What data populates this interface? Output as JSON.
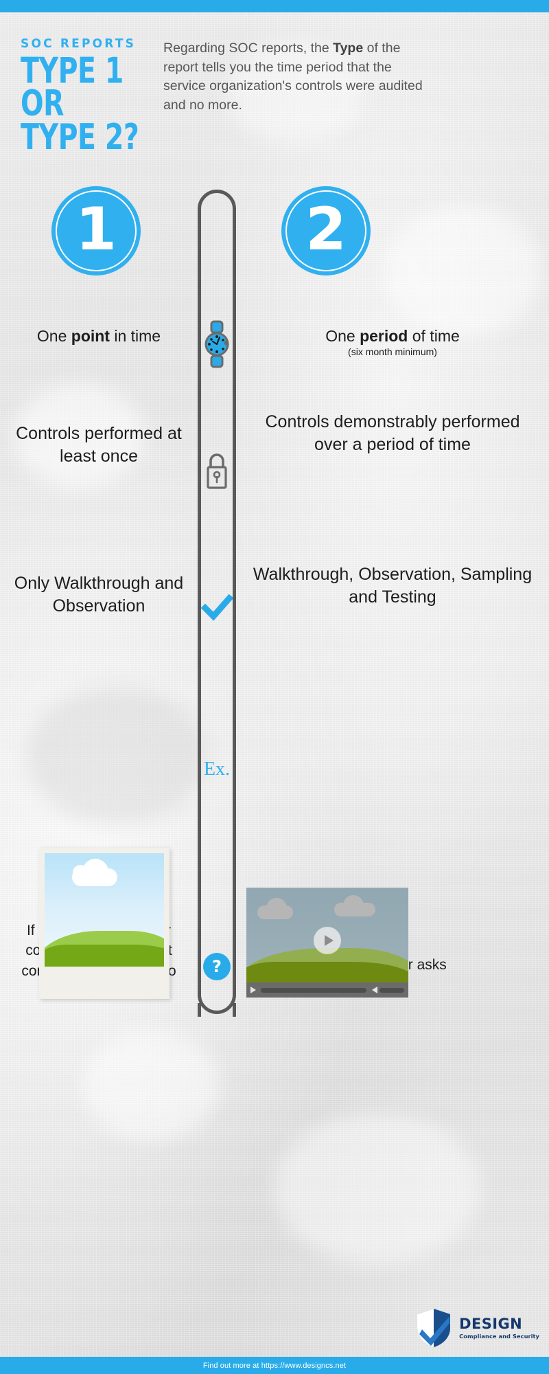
{
  "header": {
    "kicker": "SOC REPORTS",
    "title_line1": "TYPE 1 OR",
    "title_line2": "TYPE 2?",
    "intro_part1": "Regarding SOC reports, the ",
    "intro_bold": "Type",
    "intro_part2": " of the report tells you the time period that the service organization's controls were audited and no more."
  },
  "badges": {
    "left": "1",
    "right": "2"
  },
  "rows": [
    {
      "icon": "wristwatch-icon",
      "left": "One point in time",
      "left_bold": "point",
      "right": "One period of time",
      "right_bold": "period",
      "right_sub": "(six month minimum)"
    },
    {
      "icon": "padlock-icon",
      "left": "Controls performed at least once",
      "right": "Controls demonstrably performed over a period of time"
    },
    {
      "icon": "checkmark-icon",
      "left": "Only Walkthrough and Observation",
      "right": "Walkthrough, Observation, Sampling and Testing"
    },
    {
      "icon": "ex-label",
      "icon_label": "Ex.",
      "left": "photograph-polaroid",
      "right": "video-player"
    },
    {
      "icon": "question-mark-icon",
      "icon_label": "?",
      "left": "If Customer asks, your controls are new or not confident in the ability to pass a Type 2",
      "right": "If Customer asks"
    }
  ],
  "logo": {
    "name": "DESIGN",
    "tagline": "Compliance and Security"
  },
  "footer": {
    "text": "Find out more at https://www.designcs.net"
  },
  "colors": {
    "accent_blue": "#29abe9",
    "title_blue": "#31b0f0",
    "rail_gray": "#595959",
    "logo_navy": "#15386b",
    "background": "#e9e9e9"
  }
}
